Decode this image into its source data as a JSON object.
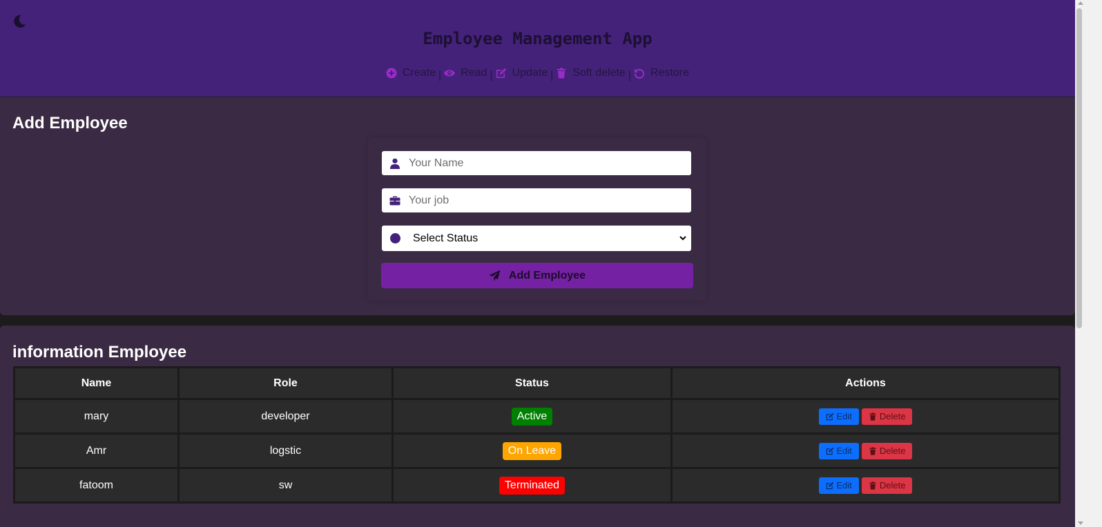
{
  "header": {
    "title": "Employee Management App",
    "nav": [
      {
        "label": "Create",
        "icon": "plus-circle-icon"
      },
      {
        "label": "Read",
        "icon": "eye-icon"
      },
      {
        "label": "Update",
        "icon": "edit-icon"
      },
      {
        "label": "Soft delete",
        "icon": "trash-icon"
      },
      {
        "label": "Restore",
        "icon": "undo-icon"
      }
    ],
    "separator": "|"
  },
  "add_form": {
    "title": "Add Employee",
    "name_placeholder": "Your Name",
    "job_placeholder": "Your job",
    "status_selected": "Select Status",
    "submit_label": "Add Employee"
  },
  "table": {
    "title": "information Employee",
    "columns": [
      "Name",
      "Role",
      "Status",
      "Actions"
    ],
    "rows": [
      {
        "name": "mary",
        "role": "developer",
        "status": "Active",
        "status_color": "#008000"
      },
      {
        "name": "Amr",
        "role": "logstic",
        "status": "On Leave",
        "status_color": "#ffa500"
      },
      {
        "name": "fatoom",
        "role": "sw",
        "status": "Terminated",
        "status_color": "#ff0000"
      }
    ],
    "edit_label": "Edit",
    "delete_label": "Delete"
  },
  "colors": {
    "header_bg": "#44227a",
    "panel_bg": "#3a2a43",
    "accent": "#7521a4",
    "nav_icon": "#9b2bc9",
    "edit_button": "#0d6efd",
    "delete_button": "#dc3545"
  }
}
